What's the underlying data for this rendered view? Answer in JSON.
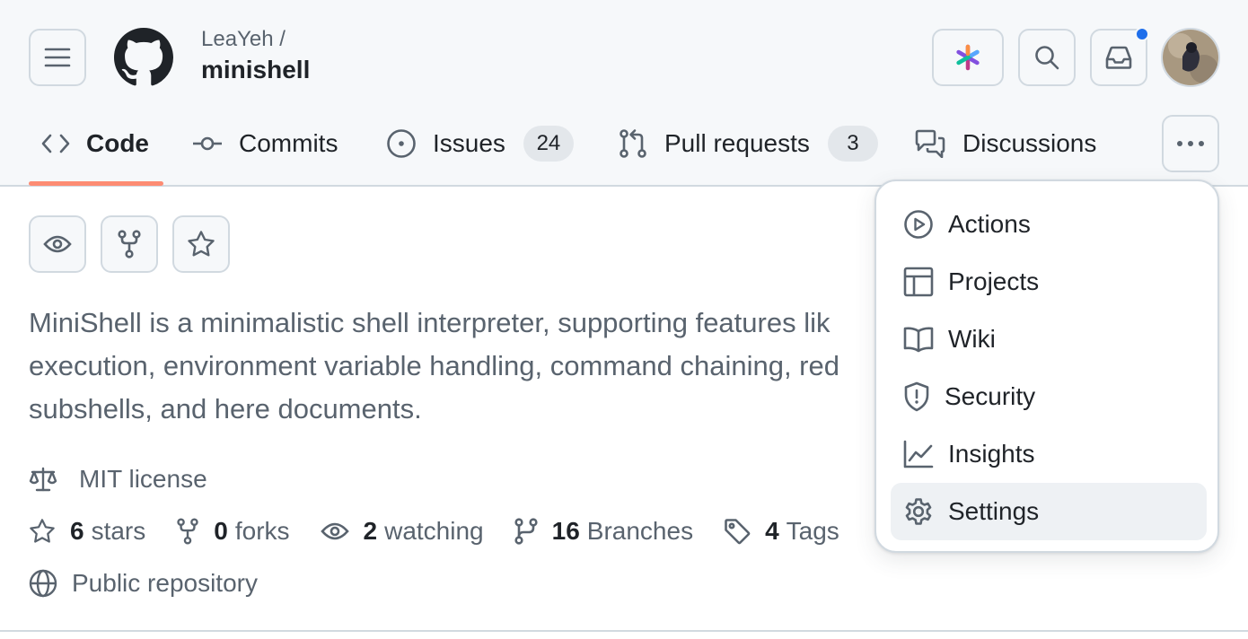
{
  "header": {
    "owner": "LeaYeh /",
    "repo_name": "minishell",
    "notification_dot_color": "#1f6feb"
  },
  "tabs": [
    {
      "label": "Code",
      "icon": "code-icon",
      "selected": true
    },
    {
      "label": "Commits",
      "icon": "commit-icon"
    },
    {
      "label": "Issues",
      "icon": "issue-icon",
      "count": "24"
    },
    {
      "label": "Pull requests",
      "icon": "pull-request-icon",
      "count": "3"
    },
    {
      "label": "Discussions",
      "icon": "discussions-icon"
    }
  ],
  "description": "MiniShell is a minimalistic shell interpreter, supporting features lik execution, environment variable handling, command chaining, red subshells, and here documents.",
  "description_lines": [
    "MiniShell is a minimalistic shell interpreter, supporting features lik",
    "execution, environment variable handling, command chaining, red",
    "subshells, and here documents."
  ],
  "license": "MIT license",
  "stats": {
    "stars_count": "6",
    "stars_label": "stars",
    "forks_count": "0",
    "forks_label": "forks",
    "watching_count": "2",
    "watching_label": "watching",
    "branches_count": "16",
    "branches_label": "Branches",
    "tags_count": "4",
    "tags_label": "Tags"
  },
  "visibility": "Public repository",
  "dropdown": {
    "items": [
      {
        "label": "Actions",
        "icon": "play-icon"
      },
      {
        "label": "Projects",
        "icon": "table-icon"
      },
      {
        "label": "Wiki",
        "icon": "book-icon"
      },
      {
        "label": "Security",
        "icon": "shield-icon"
      },
      {
        "label": "Insights",
        "icon": "graph-icon"
      },
      {
        "label": "Settings",
        "icon": "gear-icon",
        "highlighted": true
      }
    ]
  },
  "colors": {
    "selected_tab_underline": "#fd8c73",
    "header_background": "#f6f8fa",
    "counter_background": "#e3e7eb"
  }
}
